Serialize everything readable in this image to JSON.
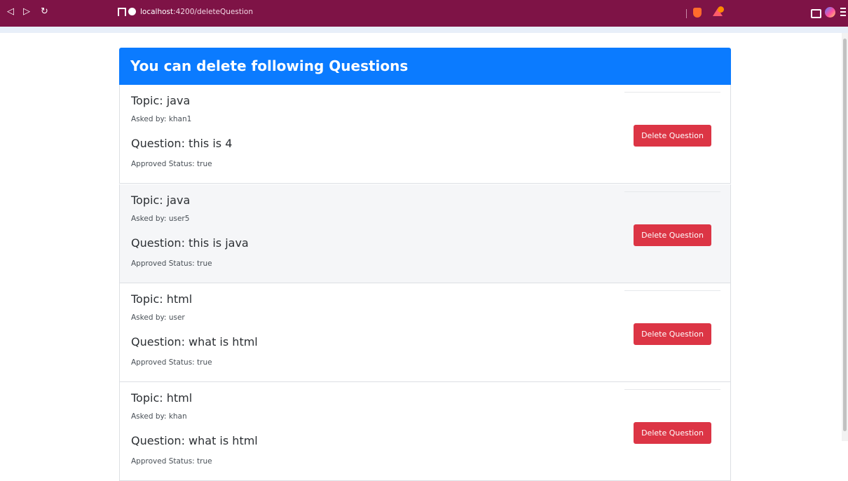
{
  "browser": {
    "url_host": "localhost",
    "url_path": ":4200/deleteQuestion",
    "icons": [
      "back-icon",
      "forward-icon",
      "reload-icon",
      "bookmark-icon",
      "info-icon",
      "brave-shield-icon",
      "brave-rewards-icon",
      "wallet-icon",
      "profile-avatar",
      "menu-icon"
    ]
  },
  "page": {
    "heading": "You can delete following Questions",
    "delete_label": "Delete Question",
    "colors": {
      "header": "#0b7bff",
      "danger": "#dc3545",
      "chrome": "#7e1346"
    }
  },
  "questions": [
    {
      "topic": "Topic: java",
      "asked_by": "Asked by: khan1",
      "question": "Question: this is 4",
      "status": "Approved Status: true"
    },
    {
      "topic": "Topic: java",
      "asked_by": "Asked by: user5",
      "question": "Question: this is java",
      "status": "Approved Status: true"
    },
    {
      "topic": "Topic: html",
      "asked_by": "Asked by: user",
      "question": "Question: what is html",
      "status": "Approved Status: true"
    },
    {
      "topic": "Topic: html",
      "asked_by": "Asked by: khan",
      "question": "Question: what is html",
      "status": "Approved Status: true"
    }
  ]
}
